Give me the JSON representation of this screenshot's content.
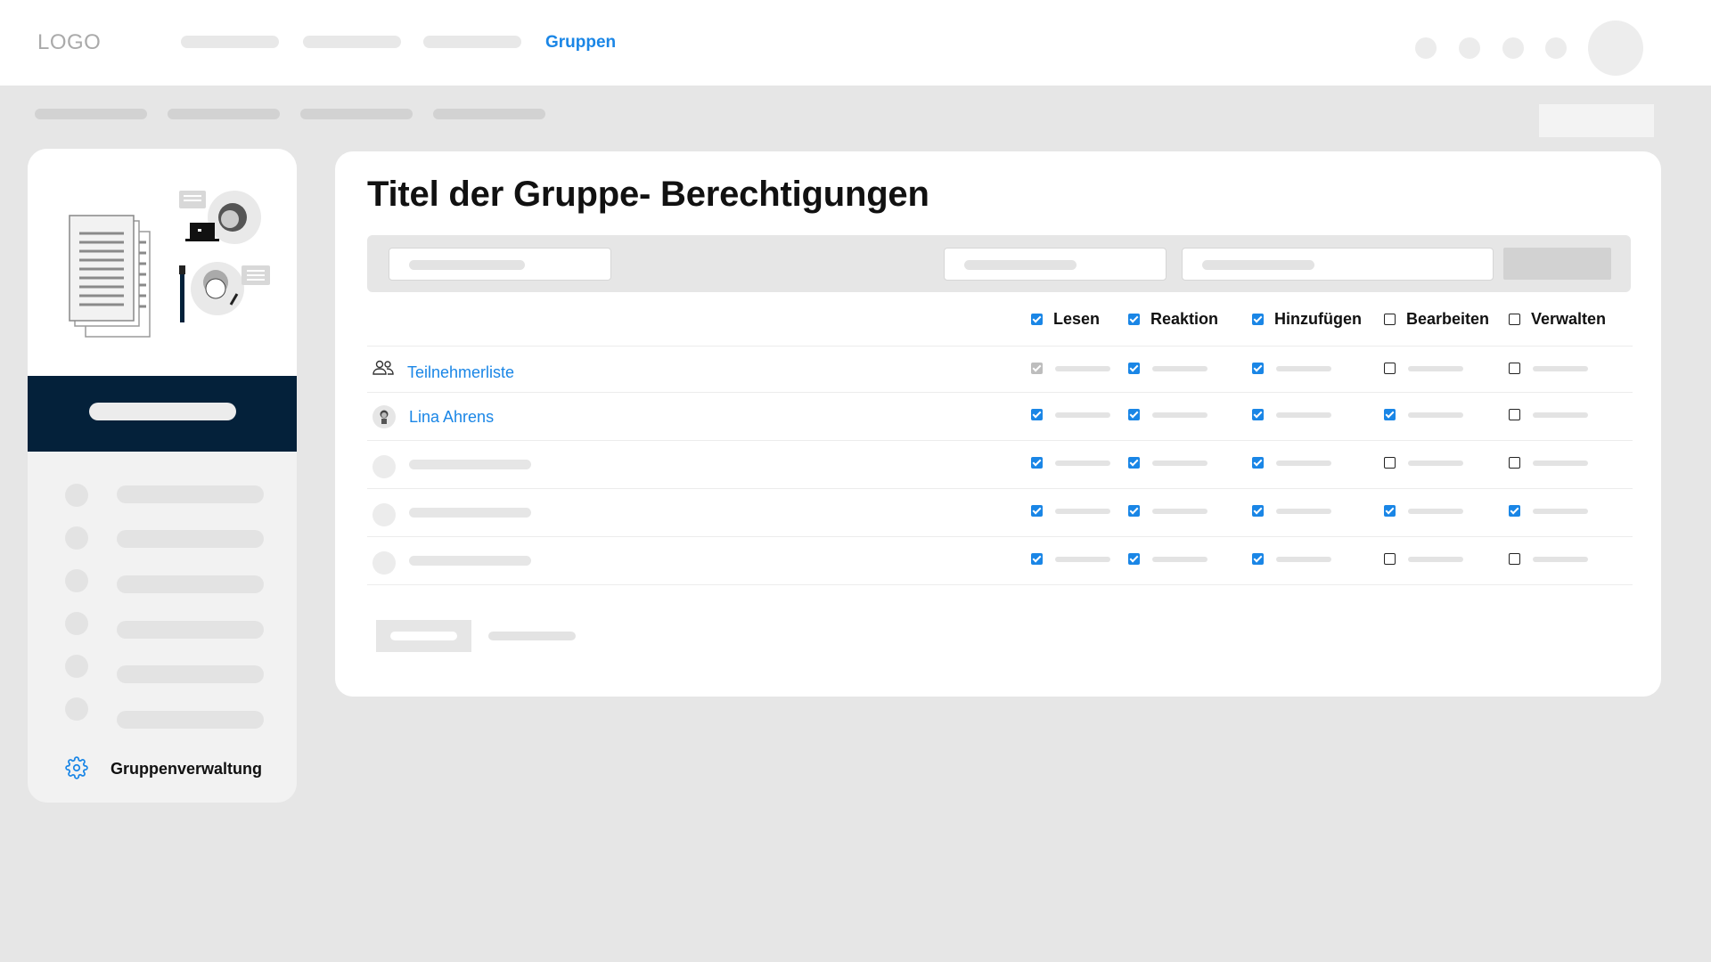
{
  "header": {
    "logo_text": "LOGO",
    "active_nav_label": "Gruppen"
  },
  "sidebar": {
    "settings_label": "Gruppenverwaltung",
    "settings_icon": "gear-icon",
    "band_color": "#04213a"
  },
  "main": {
    "title": "Titel der Gruppe- Berechtigungen",
    "columns": [
      "Lesen",
      "Reaktion",
      "Hinzufügen",
      "Bearbeiten",
      "Verwalten"
    ],
    "column_checked": [
      true,
      true,
      true,
      false,
      false
    ],
    "rows": [
      {
        "name": "Teilnehmerliste",
        "icon": "group-icon",
        "perms": [
          "disabled",
          "on",
          "on",
          "off",
          "off"
        ]
      },
      {
        "name": "Lina Ahrens",
        "icon": "avatar",
        "perms": [
          "on",
          "on",
          "on",
          "on",
          "off"
        ]
      },
      {
        "name": "",
        "icon": "",
        "perms": [
          "on",
          "on",
          "on",
          "off",
          "off"
        ]
      },
      {
        "name": "",
        "icon": "",
        "perms": [
          "on",
          "on",
          "on",
          "on",
          "on"
        ]
      },
      {
        "name": "",
        "icon": "",
        "perms": [
          "on",
          "on",
          "on",
          "off",
          "off"
        ]
      }
    ]
  },
  "colors": {
    "accent": "#1a86e6",
    "background": "#e6e6e6"
  }
}
